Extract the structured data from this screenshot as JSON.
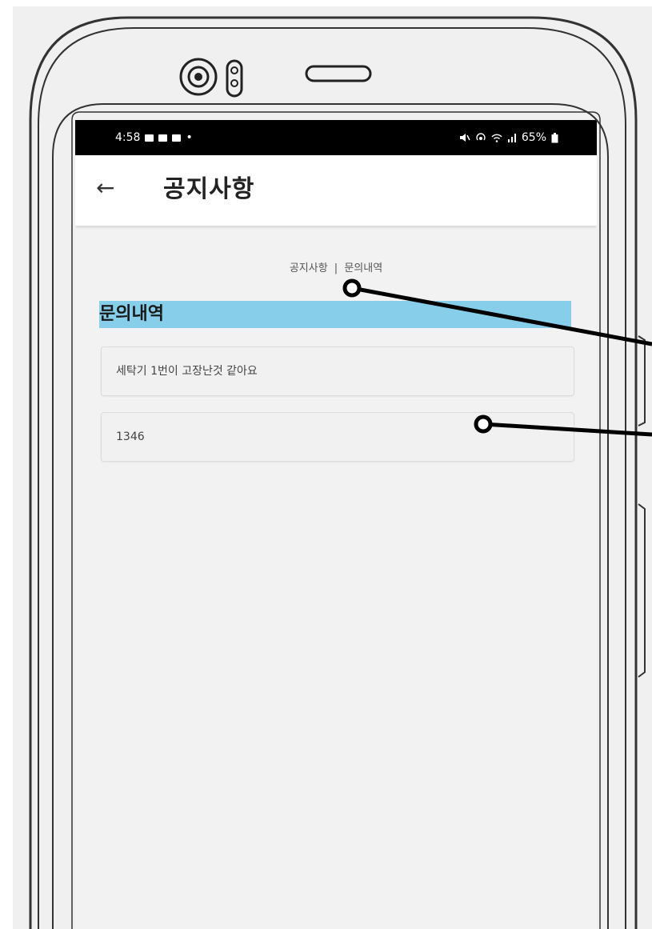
{
  "status_bar": {
    "time": "4:58",
    "indicator_dot": "•",
    "battery": "65%",
    "icons": [
      "mute-icon",
      "hotspot-icon",
      "wifi-icon",
      "signal-icon",
      "battery-icon"
    ]
  },
  "app_bar": {
    "back_icon": "←",
    "title": "공지사항"
  },
  "tabs": {
    "notice": "공지사항",
    "separator": "|",
    "inquiry": "문의내역"
  },
  "section": {
    "title": "문의내역",
    "highlight_color": "#87ceeb"
  },
  "inquiry": {
    "title_value": "세탁기 1번이 고장난것 같아요",
    "body_value": "1346"
  }
}
